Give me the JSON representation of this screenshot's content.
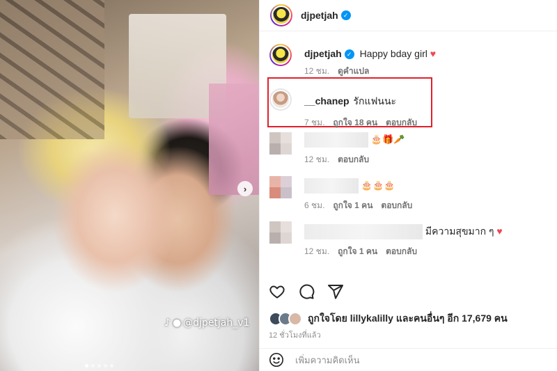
{
  "post": {
    "author": "djpetjah",
    "verified": true,
    "watermark": "@djpetjah_v1",
    "carousel_next": "›"
  },
  "caption": {
    "username": "djpetjah",
    "text": "Happy bday girl",
    "time": "12 ชม.",
    "translate": "ดูคำแปล"
  },
  "comments": [
    {
      "username": "__chanep",
      "text": "รักแฟนนะ",
      "time": "7 ชม.",
      "likes": "ถูกใจ 18 คน",
      "reply": "ตอบกลับ"
    },
    {
      "username": "",
      "text": "🎂🎁🥕",
      "time": "12 ชม.",
      "likes": "",
      "reply": "ตอบกลับ"
    },
    {
      "username": "",
      "text": "🎂🎂🎂",
      "time": "6 ชม.",
      "likes": "ถูกใจ 1 คน",
      "reply": "ตอบกลับ"
    },
    {
      "username": "",
      "text": "มีความสุขมาก ๆ",
      "time": "12 ชม.",
      "likes": "ถูกใจ 1 คน",
      "reply": "ตอบกลับ"
    }
  ],
  "liked_by": "ถูกใจโดย lillykalilly และคนอื่นๆ อีก 17,679 คน",
  "posted_ago": "12 ชั่วโมงที่แล้ว",
  "add_comment_placeholder": "เพิ่มความคิดเห็น",
  "colors": {
    "highlight": "#e0202a",
    "verified": "#0095f6",
    "heart": "#ed4956"
  }
}
